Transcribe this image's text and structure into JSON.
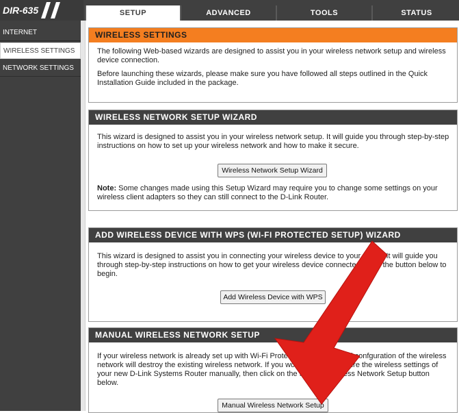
{
  "header": {
    "model": "DIR-635",
    "tabs": [
      {
        "label": "SETUP",
        "active": true
      },
      {
        "label": "ADVANCED",
        "active": false
      },
      {
        "label": "TOOLS",
        "active": false
      },
      {
        "label": "STATUS",
        "active": false
      }
    ]
  },
  "sidebar": {
    "items": [
      {
        "label": "INTERNET",
        "active": false
      },
      {
        "label": "WIRELESS SETTINGS",
        "active": true
      },
      {
        "label": "NETWORK SETTINGS",
        "active": false
      }
    ]
  },
  "wireless_settings": {
    "title": "WIRELESS SETTINGS",
    "para1": "The following Web-based wizards are designed to assist you in your wireless network setup and wireless device connection.",
    "para2": "Before launching these wizards, please make sure you have followed all steps outlined in the Quick Installation Guide included in the package."
  },
  "setup_wizard": {
    "title": "WIRELESS NETWORK SETUP WIZARD",
    "text": "This wizard is designed to assist you in your wireless network setup. It will guide you through step-by-step instructions on how to set up your wireless network and how to make it secure.",
    "button": "Wireless Network Setup Wizard",
    "note_label": "Note:",
    "note_text": " Some changes made using this Setup Wizard may require you to change some settings on your wireless client adapters so they can still connect to the D-Link Router."
  },
  "wps_wizard": {
    "title": "ADD WIRELESS DEVICE WITH WPS (WI-FI PROTECTED SETUP) WIZARD",
    "text": "This wizard is designed to assist you in connecting your wireless device to your router. It will guide you through step-by-step instructions on how to get your wireless device connected. Click the button below to begin.",
    "button": "Add Wireless Device with WPS"
  },
  "manual_setup": {
    "title": "MANUAL WIRELESS NETWORK SETUP",
    "text": "If your wireless network is already set up with Wi-Fi Protected Setup, manual confguration of the wireless network will destroy the existing wireless network. If you would like to configure the wireless settings of your new D-Link Systems Router manually, then click on the Manual Wireless Network Setup button below.",
    "button": "Manual Wireless Network Setup"
  },
  "colors": {
    "nav_dark": "#404040",
    "accent_orange": "#f47e20",
    "arrow_red": "#e0201a"
  }
}
